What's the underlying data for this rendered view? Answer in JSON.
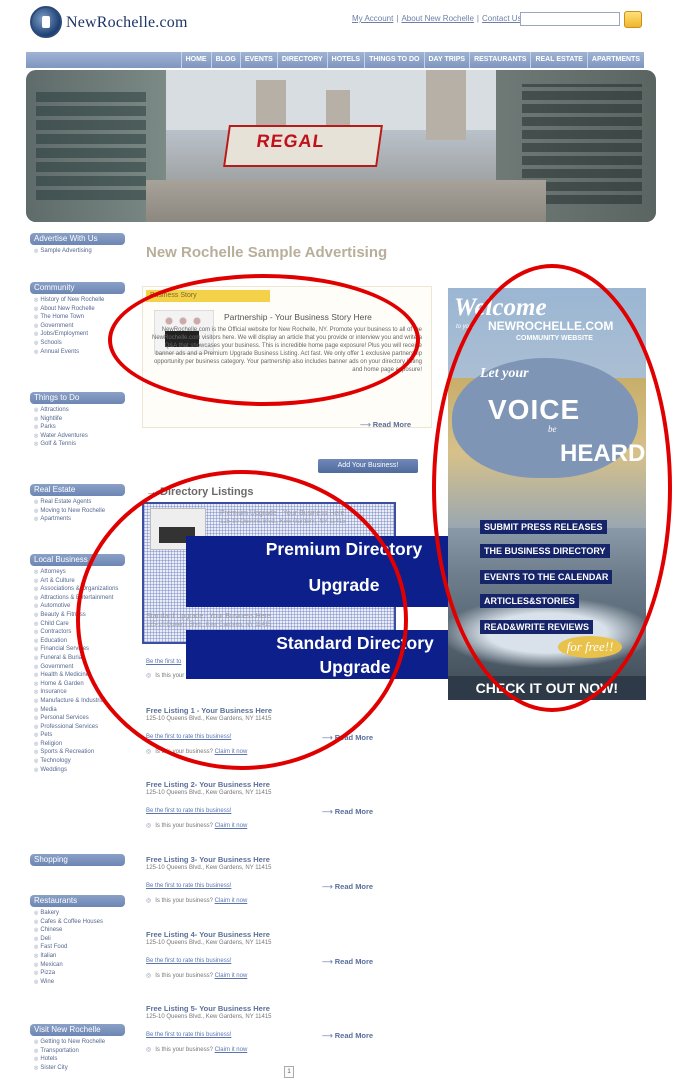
{
  "header": {
    "logo_text": "NewRochelle.com",
    "links": [
      "My Account",
      "About New Rochelle",
      "Contact Us"
    ],
    "link_separator": "|",
    "search_placeholder": ""
  },
  "nav": {
    "items": [
      "HOME",
      "BLOG",
      "EVENTS",
      "DIRECTORY",
      "HOTELS",
      "THINGS TO DO",
      "DAY TRIPS",
      "RESTAURANTS",
      "REAL ESTATE",
      "APARTMENTS"
    ]
  },
  "hero": {
    "marquee_text": "REGAL"
  },
  "sidebar": {
    "advertise": {
      "title": "Advertise With Us",
      "items": [
        "Sample Advertising"
      ]
    },
    "community": {
      "title": "Community",
      "items": [
        "History of New Rochelle",
        "About New Rochelle",
        "The Home Town",
        "Government",
        "Jobs/Employment",
        "Schools",
        "Annual Events"
      ]
    },
    "things_to_do": {
      "title": "Things to Do",
      "items": [
        "Attractions",
        "Nightlife",
        "Parks",
        "Water Adventures",
        "Golf & Tennis"
      ]
    },
    "real_estate": {
      "title": "Real Estate",
      "items": [
        "Real Estate Agents",
        "Moving to New Rochelle",
        "Apartments"
      ]
    },
    "local_business": {
      "title": "Local Business",
      "items": [
        "Attorneys",
        "Art & Culture",
        "Associations & Organizations",
        "Attractions & Entertainment",
        "Automotive",
        "Beauty & Fitness",
        "Child Care",
        "Contractors",
        "Education",
        "Financial Services",
        "Funeral & Burial",
        "Government",
        "Health & Medicine",
        "Home & Garden",
        "Insurance",
        "Manufacture & Industrial",
        "Media",
        "Personal Services",
        "Professional Services",
        "Pets",
        "Religion",
        "Sports & Recreation",
        "Technology",
        "Weddings"
      ]
    },
    "shopping": {
      "title": "Shopping"
    },
    "restaurants": {
      "title": "Restaurants",
      "items": [
        "Bakery",
        "Cafes & Coffee Houses",
        "Chinese",
        "Deli",
        "Fast Food",
        "Italian",
        "Mexican",
        "Pizza",
        "Wine"
      ]
    },
    "visit": {
      "title": "Visit New Rochelle",
      "items": [
        "Getting to New Rochelle",
        "Transportation",
        "Hotels",
        "Sister City"
      ]
    }
  },
  "main": {
    "title": "New Rochelle Sample Advertising",
    "story": {
      "tab_label": "Business Story",
      "headline": "Partnership - Your Business Story Here",
      "text": "NewRochelle.com is the Official website for New Rochelle, NY. Promote your business to all of the NewRochelle.com visitors here. We will display an article that you provide or interview you and write a Q&A that showcases your business. This is incredible home page exposure! Plus you will receive banner ads and a Premium Upgrade Business Listing. Act fast. We only offer 1 exclusive partnership opportunity per business category. Your partnership also includes banner ads on your directory listing and home page exposure!",
      "read_more": "Read More"
    },
    "add_business": "Add Your Business!",
    "directory_heading": "Directory Listings",
    "premium": {
      "title": "Premium Upgrade - Your Business Here",
      "address": "125-10 Queens Blvd., Kew Gardens, NY 11415"
    },
    "standard": {
      "title": "Standard Upgrade - Your Business Here",
      "address": "125-10 Queens Blvd., Kew Gardens, NY 11415"
    },
    "overlays": {
      "premium_line1": "Premium Directory",
      "premium_line2": "Upgrade",
      "standard_line1": "Standard Directory",
      "standard_line2": "Upgrade"
    },
    "standard_rate": "Be the first to",
    "standard_claim": "Is this your",
    "listings": [
      {
        "title": "Free Listing 1 - Your Business Here",
        "address": "125-10 Queens Blvd., Kew Gardens, NY 11415",
        "rate": "Be the first to rate this business!",
        "claim": "Is this your business?",
        "claim_link": "Claim it now",
        "read_more": "Read More"
      },
      {
        "title": "Free Listing 2- Your Business Here",
        "address": "125-10 Queens Blvd., Kew Gardens, NY 11415",
        "rate": "Be the first to rate this business!",
        "claim": "Is this your business?",
        "claim_link": "Claim it now",
        "read_more": "Read More"
      },
      {
        "title": "Free Listing 3- Your Business Here",
        "address": "125-10 Queens Blvd., Kew Gardens, NY 11415",
        "rate": "Be the first to rate this business!",
        "claim": "Is this your business?",
        "claim_link": "Claim it now",
        "read_more": "Read More"
      },
      {
        "title": "Free Listing 4- Your Business Here",
        "address": "125-10 Queens Blvd., Kew Gardens, NY 11415",
        "rate": "Be the first to rate this business!",
        "claim": "Is this your business?",
        "claim_link": "Claim it now",
        "read_more": "Read More"
      },
      {
        "title": "Free Listing 5- Your Business Here",
        "address": "125-10 Queens Blvd., Kew Gardens, NY 11415",
        "rate": "Be the first to rate this business!",
        "claim": "Is this your business?",
        "claim_link": "Claim it now",
        "read_more": "Read More"
      }
    ],
    "pager": "1"
  },
  "banner": {
    "welcome": "Welcome",
    "to_your": "to your",
    "site_name": "NEWROCHELLE.COM",
    "community": "COMMUNITY WEBSITE",
    "let_your": "Let your",
    "voice": "VOICE",
    "be": "be",
    "heard": "HEARD",
    "features": [
      "SUBMIT PRESS RELEASES",
      "THE BUSINESS DIRECTORY",
      "EVENTS TO THE CALENDAR",
      "ARTICLES&STORIES",
      "READ&WRITE REVIEWS"
    ],
    "for_free": "for free!!",
    "cta": "CHECK IT OUT NOW!"
  },
  "colors": {
    "nav": "#8aa0c6",
    "overlay": "#0d1f8a",
    "annotation": "#e00000",
    "story_tab": "#f3d24a"
  }
}
